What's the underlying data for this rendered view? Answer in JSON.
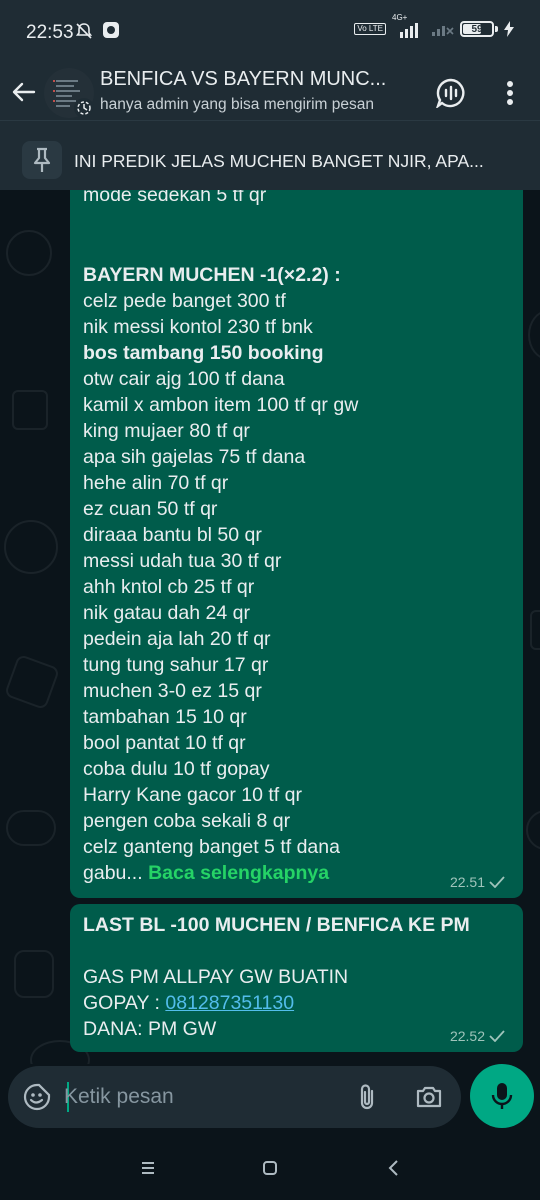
{
  "status_bar": {
    "time": "22:53",
    "network": "4G+",
    "volte": "Vo LTE",
    "battery": "59",
    "battery_level": 0.59
  },
  "header": {
    "title": "BENFICA VS BAYERN MUNC...",
    "subtitle": "hanya admin yang bisa mengirim pesan"
  },
  "pinned": {
    "text": "INI PREDIK JELAS MUCHEN BANGET NJIR, APA..."
  },
  "messages": [
    {
      "cut_line": "mode sedekah 5 tf qr",
      "heading": "BAYERN MUCHEN -1(×2.2) :",
      "lines": [
        "celz pede banget 300 tf",
        "nik messi kontol 230 tf bnk",
        "bos tambang 150 booking",
        "otw cair ajg 100 tf dana",
        "kamil x ambon item 100 tf qr gw",
        "king mujaer 80 tf qr",
        "apa sih gajelas 75 tf dana",
        "hehe alin 70 tf qr",
        "ez cuan 50 tf qr",
        "diraaa bantu bl 50 qr",
        "messi udah tua 30 tf qr",
        "ahh kntol cb 25 tf qr",
        "nik gatau dah 24 qr",
        "pedein aja lah 20 tf qr",
        "tung tung sahur 17 qr",
        "muchen 3-0 ez 15 qr",
        "tambahan 15 10 qr",
        "bool pantat 10 tf qr",
        "coba dulu 10 tf gopay",
        "Harry Kane gacor 10 tf qr",
        "pengen coba sekali 8 qr",
        "celz ganteng banget 5 tf dana"
      ],
      "truncated": "gabu...",
      "read_more": "Baca selengkapnya",
      "time": "22.51"
    },
    {
      "heading": "LAST BL -100 MUCHEN / BENFICA KE PM",
      "line1": "GAS PM ALLPAY GW BUATIN",
      "gopay_label": "GOPAY : ",
      "gopay_number": "081287351130",
      "line3": "DANA: PM GW",
      "time": "22.52"
    }
  ],
  "composer": {
    "placeholder": "Ketik pesan"
  },
  "colors": {
    "header_bg": "#1f2c34",
    "chat_bg": "#0b141a",
    "outgoing_bubble": "#005c4b",
    "accent": "#00a884",
    "link": "#53bdeb",
    "read_more": "#25d366"
  },
  "icons": {
    "status": [
      "mute-bell-icon",
      "app-notification-icon",
      "signal-icon",
      "battery-icon",
      "charging-icon"
    ],
    "header": [
      "back-arrow-icon",
      "group-avatar",
      "voice-chat-icon",
      "more-vert-icon"
    ],
    "composer": [
      "emoji-icon",
      "attach-icon",
      "camera-icon",
      "mic-icon"
    ],
    "nav": [
      "recents-icon",
      "home-icon",
      "back-nav-icon"
    ]
  }
}
